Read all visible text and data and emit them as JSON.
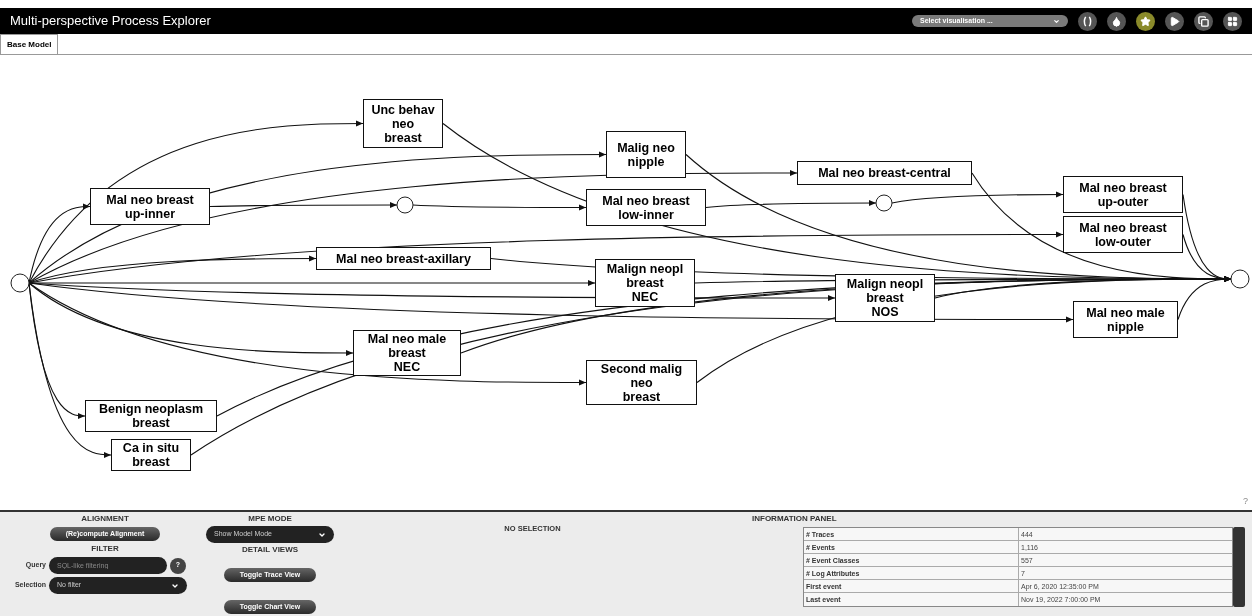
{
  "window": {
    "title": "Multi-perspective Process Explorer"
  },
  "visualisation_select": {
    "value": "Select visualisation ..."
  },
  "toolbar": [
    {
      "kind": "brackets",
      "selected": false
    },
    {
      "kind": "drop",
      "selected": false
    },
    {
      "kind": "star",
      "selected": true
    },
    {
      "kind": "play",
      "selected": false
    },
    {
      "kind": "copy",
      "selected": false
    },
    {
      "kind": "grid",
      "selected": false
    }
  ],
  "tabs": [
    {
      "label": "Base Model",
      "selected": true
    }
  ],
  "model": {
    "nodes": [
      {
        "label": "Unc behav\nneo\nbreast"
      },
      {
        "label": "Malig neo\nnipple"
      },
      {
        "label": "Mal neo breast-central"
      },
      {
        "label": "Mal neo breast\nup-inner"
      },
      {
        "label": "Mal neo breast\nlow-inner"
      },
      {
        "label": "Mal neo breast\nup-outer"
      },
      {
        "label": "Mal neo breast\nlow-outer"
      },
      {
        "label": "Mal neo breast-axillary"
      },
      {
        "label": "Malign neopl\nbreast\nNEC"
      },
      {
        "label": "Malign neopl\nbreast\nNOS"
      },
      {
        "label": "Mal neo male\nnipple"
      },
      {
        "label": "Mal neo male\nbreast\nNEC"
      },
      {
        "label": "Second malig\nneo\nbreast"
      },
      {
        "label": "Benign neoplasm\nbreast"
      },
      {
        "label": "Ca in situ\nbreast"
      }
    ],
    "help": "?"
  },
  "alignment": {
    "heading": "ALIGNMENT",
    "button": "(Re)compute Alignment"
  },
  "mpe_mode": {
    "heading": "MPE MODE",
    "value": "Show Model Mode"
  },
  "filter": {
    "heading": "FILTER",
    "query_label": "Query",
    "query_placeholder": "SQL-like filtering",
    "help": "?",
    "selection_label": "Selection",
    "selection_value": "No filter"
  },
  "detail_views": {
    "heading": "DETAIL VIEWS",
    "buttons": [
      "Toggle Trace View",
      "Toggle Chart View"
    ]
  },
  "selection_status": "NO SELECTION",
  "information_panel": {
    "heading": "INFORMATION PANEL",
    "rows": [
      {
        "label": "# Traces",
        "value": "444"
      },
      {
        "label": "# Events",
        "value": "1,116"
      },
      {
        "label": "# Event Classes",
        "value": "557"
      },
      {
        "label": "# Log Attributes",
        "value": "7"
      },
      {
        "label": "First event",
        "value": "Apr 6, 2020 12:35:00 PM"
      },
      {
        "label": "Last event",
        "value": "Nov 19, 2022 7:00:00 PM"
      }
    ]
  }
}
